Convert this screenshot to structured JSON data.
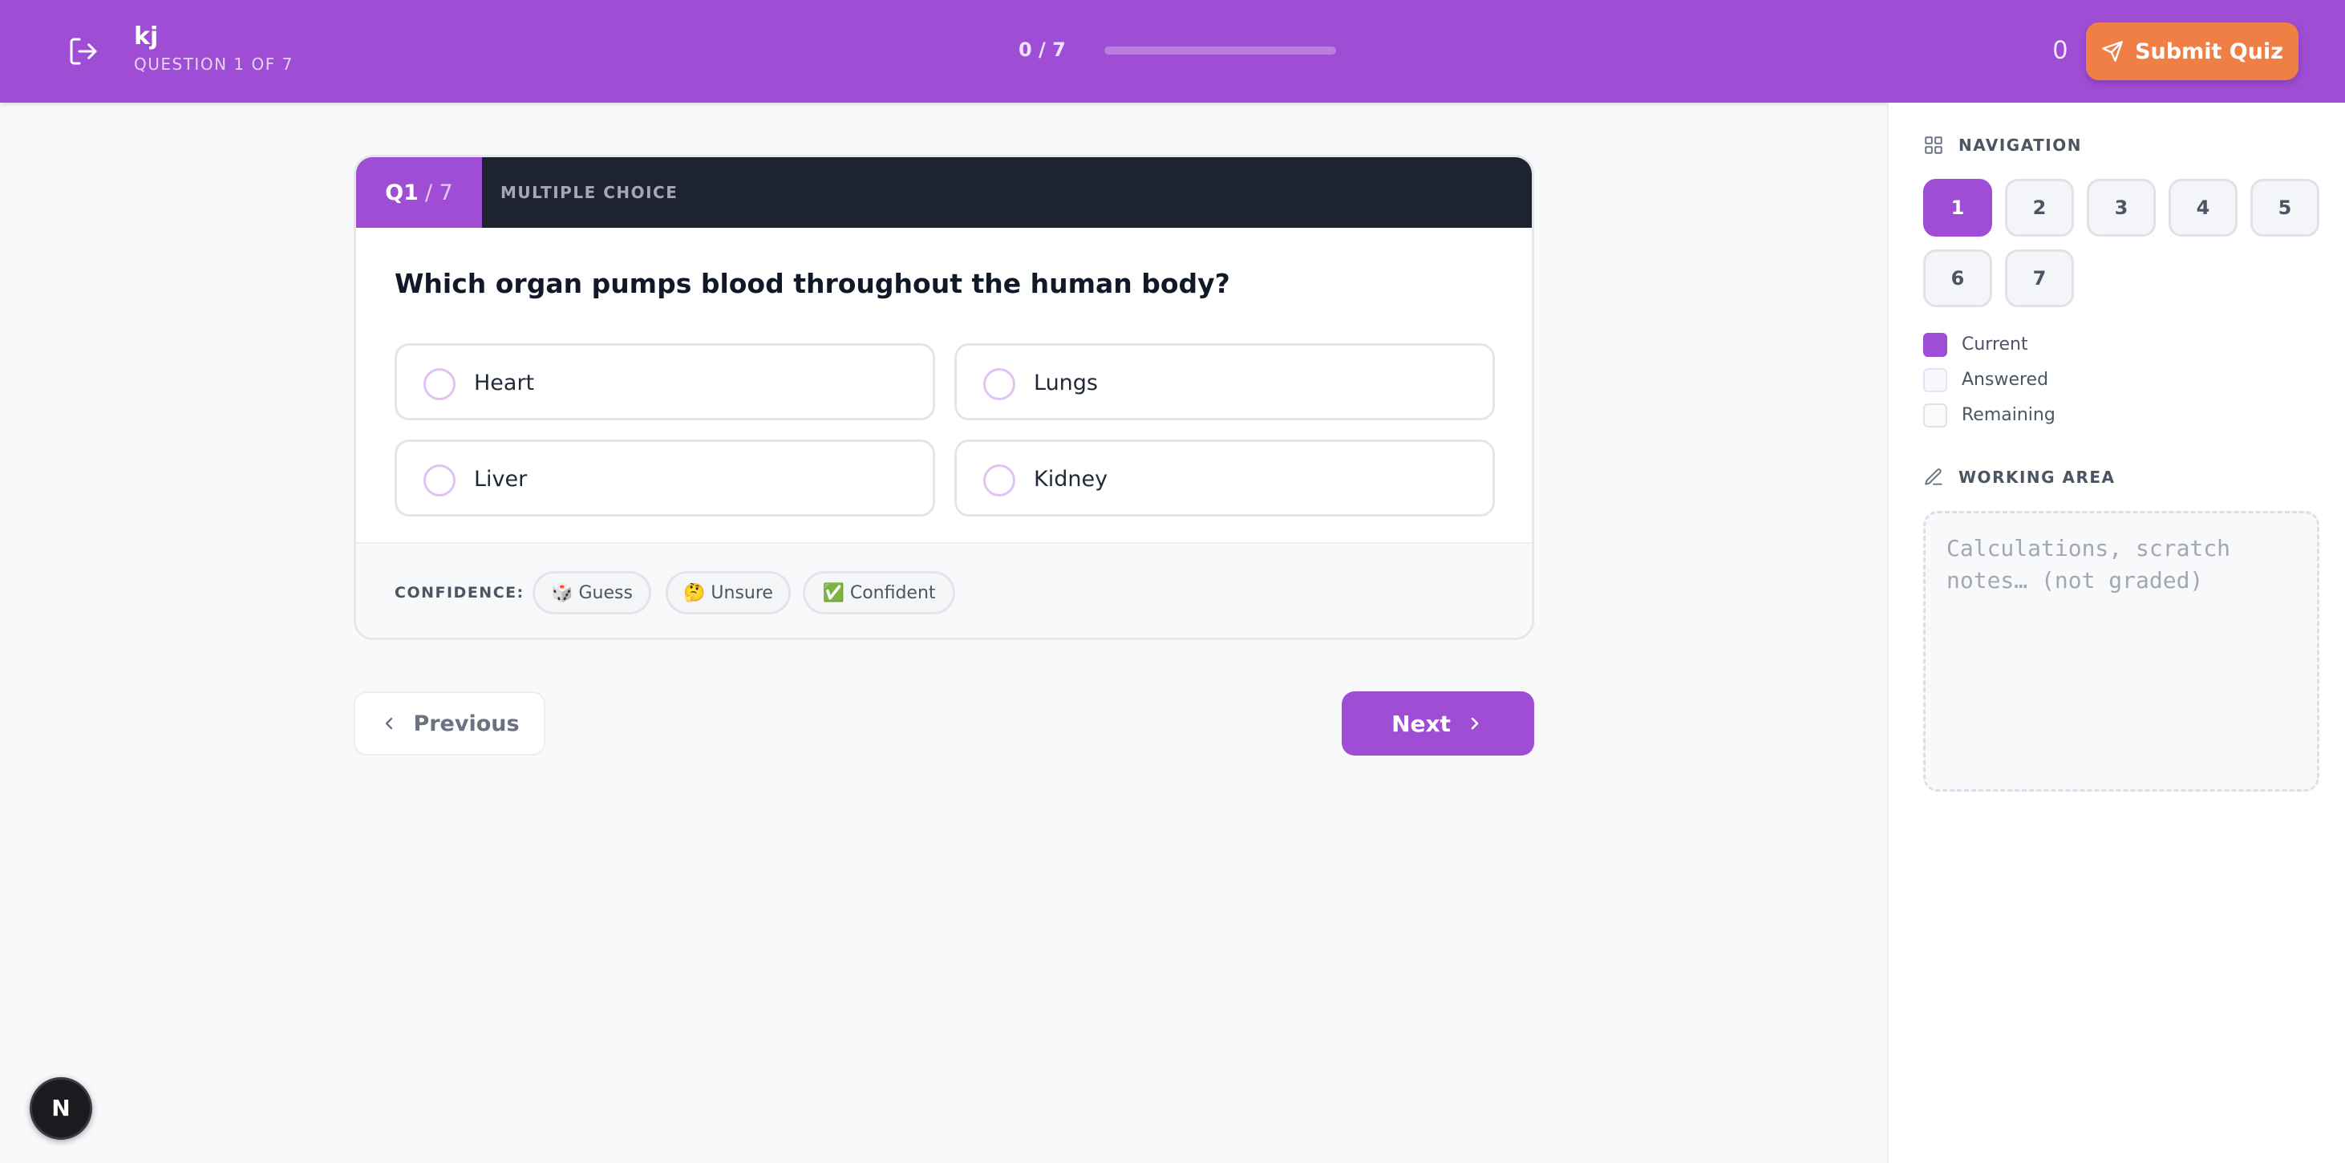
{
  "colors": {
    "brand_purple": "#a04dd6",
    "accent_orange": "#ef7f45",
    "dark_header": "#1e2330",
    "page_bg": "#f8f9fb"
  },
  "header": {
    "exit_icon": "logout-icon",
    "title": "kj",
    "subtitle": "QUESTION 1 OF 7",
    "progress_text": "0 / 7",
    "progress_fraction": 0,
    "score": "0",
    "submit_label": "Submit Quiz",
    "submit_icon": "send-icon"
  },
  "question": {
    "number": "Q1",
    "total": "/ 7",
    "type": "MULTIPLE CHOICE",
    "text": "Which organ pumps blood throughout the human body?",
    "options": [
      {
        "label": "Heart"
      },
      {
        "label": "Lungs"
      },
      {
        "label": "Liver"
      },
      {
        "label": "Kidney"
      }
    ],
    "confidence_label": "CONFIDENCE:",
    "confidence_options": [
      {
        "label": "🎲 Guess"
      },
      {
        "label": "🤔 Unsure"
      },
      {
        "label": "✅ Confident"
      }
    ]
  },
  "navigation_buttons": {
    "previous_label": "Previous",
    "next_label": "Next"
  },
  "sidebar": {
    "navigation_title": "NAVIGATION",
    "question_buttons": [
      "1",
      "2",
      "3",
      "4",
      "5",
      "6",
      "7"
    ],
    "current_question": "1",
    "legend": [
      {
        "label": "Current"
      },
      {
        "label": "Answered"
      },
      {
        "label": "Remaining"
      }
    ],
    "working_area_title": "WORKING AREA",
    "working_area_placeholder": "Calculations, scratch notes… (not graded)",
    "working_area_value": ""
  },
  "dev_badge_letter": "N"
}
